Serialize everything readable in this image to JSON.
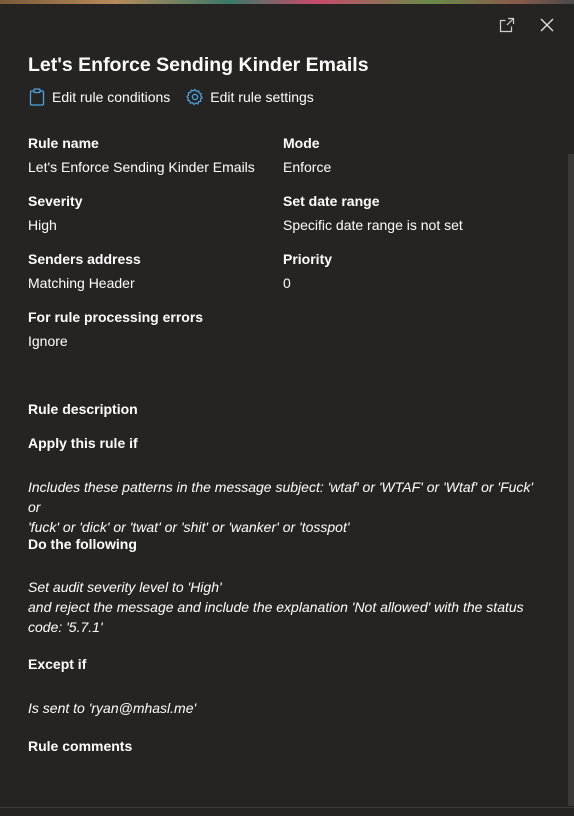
{
  "window": {
    "title": "Let's Enforce Sending Kinder Emails",
    "popout_icon": "popout-icon",
    "close_icon": "close-icon"
  },
  "commands": {
    "edit_conditions": {
      "label": "Edit rule conditions",
      "icon": "clipboard-icon"
    },
    "edit_settings": {
      "label": "Edit rule settings",
      "icon": "gear-icon"
    }
  },
  "details": {
    "rule_name": {
      "label": "Rule name",
      "value": "Let's Enforce Sending Kinder Emails"
    },
    "mode": {
      "label": "Mode",
      "value": "Enforce"
    },
    "severity": {
      "label": "Severity",
      "value": "High"
    },
    "date_range": {
      "label": "Set date range",
      "value": "Specific date range is not set"
    },
    "senders_address": {
      "label": "Senders address",
      "value": "Matching Header"
    },
    "priority": {
      "label": "Priority",
      "value": "0"
    },
    "processing_errors": {
      "label": "For rule processing errors",
      "value": "Ignore"
    }
  },
  "description": {
    "heading": "Rule description",
    "apply_heading": "Apply this rule if",
    "apply_text_1": "Includes these patterns in the message subject: 'wtaf' or 'WTAF' or 'Wtaf' or 'Fuck' or",
    "apply_text_2": "'fuck' or 'dick' or 'twat' or 'shit' or 'wanker' or 'tosspot'",
    "do_heading": "Do the following",
    "do_text_1": "Set audit severity level to 'High'",
    "do_text_2": "and reject the message and include the explanation 'Not allowed' with the status",
    "do_text_3": "code: '5.7.1'",
    "except_heading": "Except if",
    "except_text": "Is sent to 'ryan@mhasl.me'",
    "comments_heading": "Rule comments"
  },
  "colors": {
    "background": "#252423",
    "accent": "#4fa3e0",
    "text": "#ffffff"
  }
}
